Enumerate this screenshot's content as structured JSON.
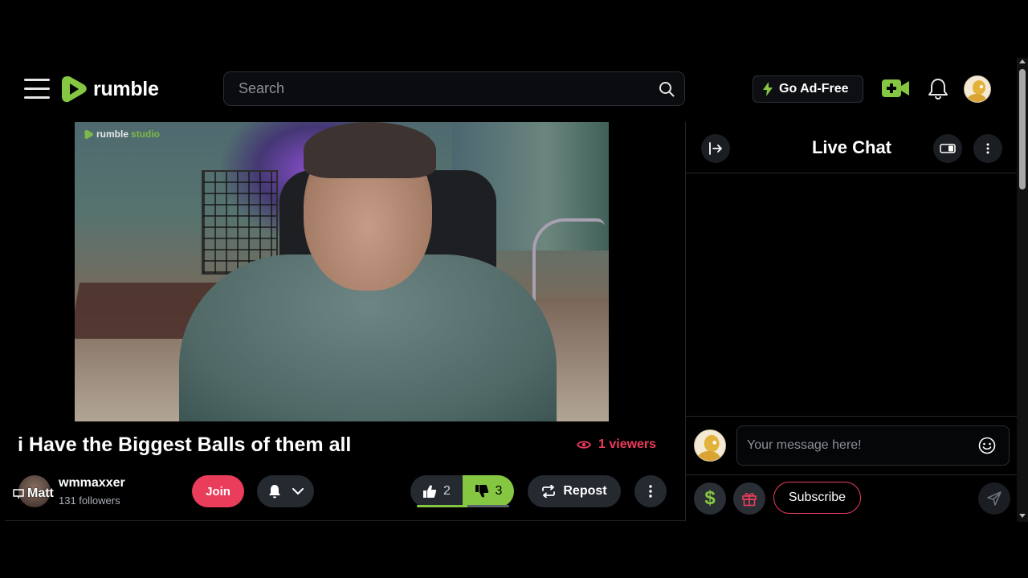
{
  "header": {
    "logo_text": "rumble",
    "search_placeholder": "Search",
    "adfree_label": "Go Ad-Free",
    "icons": [
      "menu-icon",
      "search-icon",
      "lightning-icon",
      "upload-icon",
      "bell-icon"
    ]
  },
  "video": {
    "watermark": {
      "brand": "rumble",
      "sub": "studio"
    },
    "title": "i Have the Biggest Balls of them all",
    "viewers": "1 viewers"
  },
  "channel": {
    "name": "wmmaxxer",
    "followers": "131 followers",
    "overlay_name": "Matt",
    "join_label": "Join"
  },
  "actions": {
    "likes": "2",
    "dislikes": "3",
    "vote_ratio": 0.55,
    "repost_label": "Repost"
  },
  "chat": {
    "title": "Live Chat",
    "input_placeholder": "Your message here!",
    "rant_symbol": "$",
    "subscribe_label": "Subscribe"
  },
  "colors": {
    "brand_green": "#85c742",
    "accent_red": "#ea3d5c",
    "button_dark": "#252a30"
  }
}
